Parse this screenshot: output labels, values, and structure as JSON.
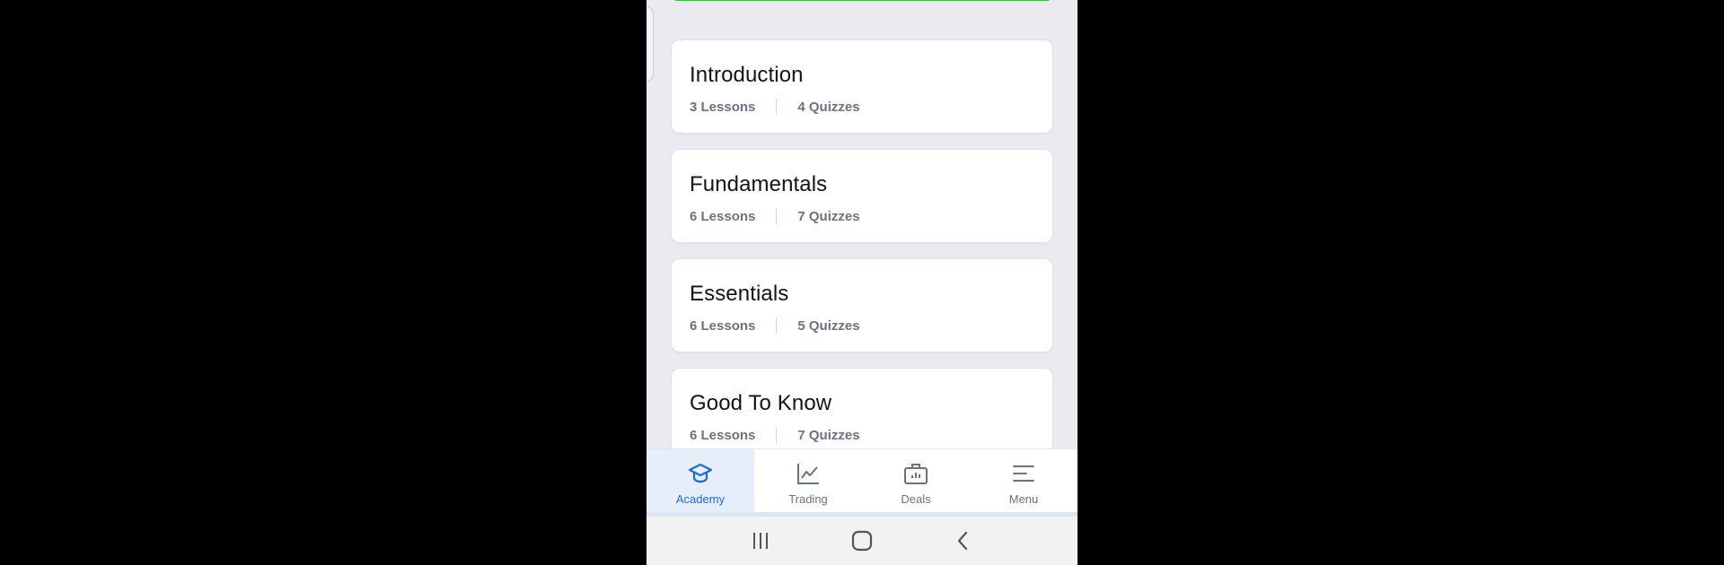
{
  "courses": [
    {
      "title": "Introduction",
      "lessons": "3 Lessons",
      "quizzes": "4 Quizzes"
    },
    {
      "title": "Fundamentals",
      "lessons": "6 Lessons",
      "quizzes": "7 Quizzes"
    },
    {
      "title": "Essentials",
      "lessons": "6 Lessons",
      "quizzes": "5 Quizzes"
    },
    {
      "title": "Good To Know",
      "lessons": "6 Lessons",
      "quizzes": "7 Quizzes"
    }
  ],
  "tabbar": {
    "items": [
      {
        "label": "Academy",
        "icon": "graduation-cap-icon",
        "active": true
      },
      {
        "label": "Trading",
        "icon": "line-chart-icon",
        "active": false
      },
      {
        "label": "Deals",
        "icon": "briefcase-icon",
        "active": false
      },
      {
        "label": "Menu",
        "icon": "menu-lines-icon",
        "active": false
      }
    ]
  },
  "system_nav": {
    "buttons": [
      "recent-apps-icon",
      "home-icon",
      "back-icon"
    ]
  },
  "colors": {
    "accent": "#1a6bd6",
    "progress_bar": "#4caf50",
    "page_background": "#e9ebf0"
  }
}
